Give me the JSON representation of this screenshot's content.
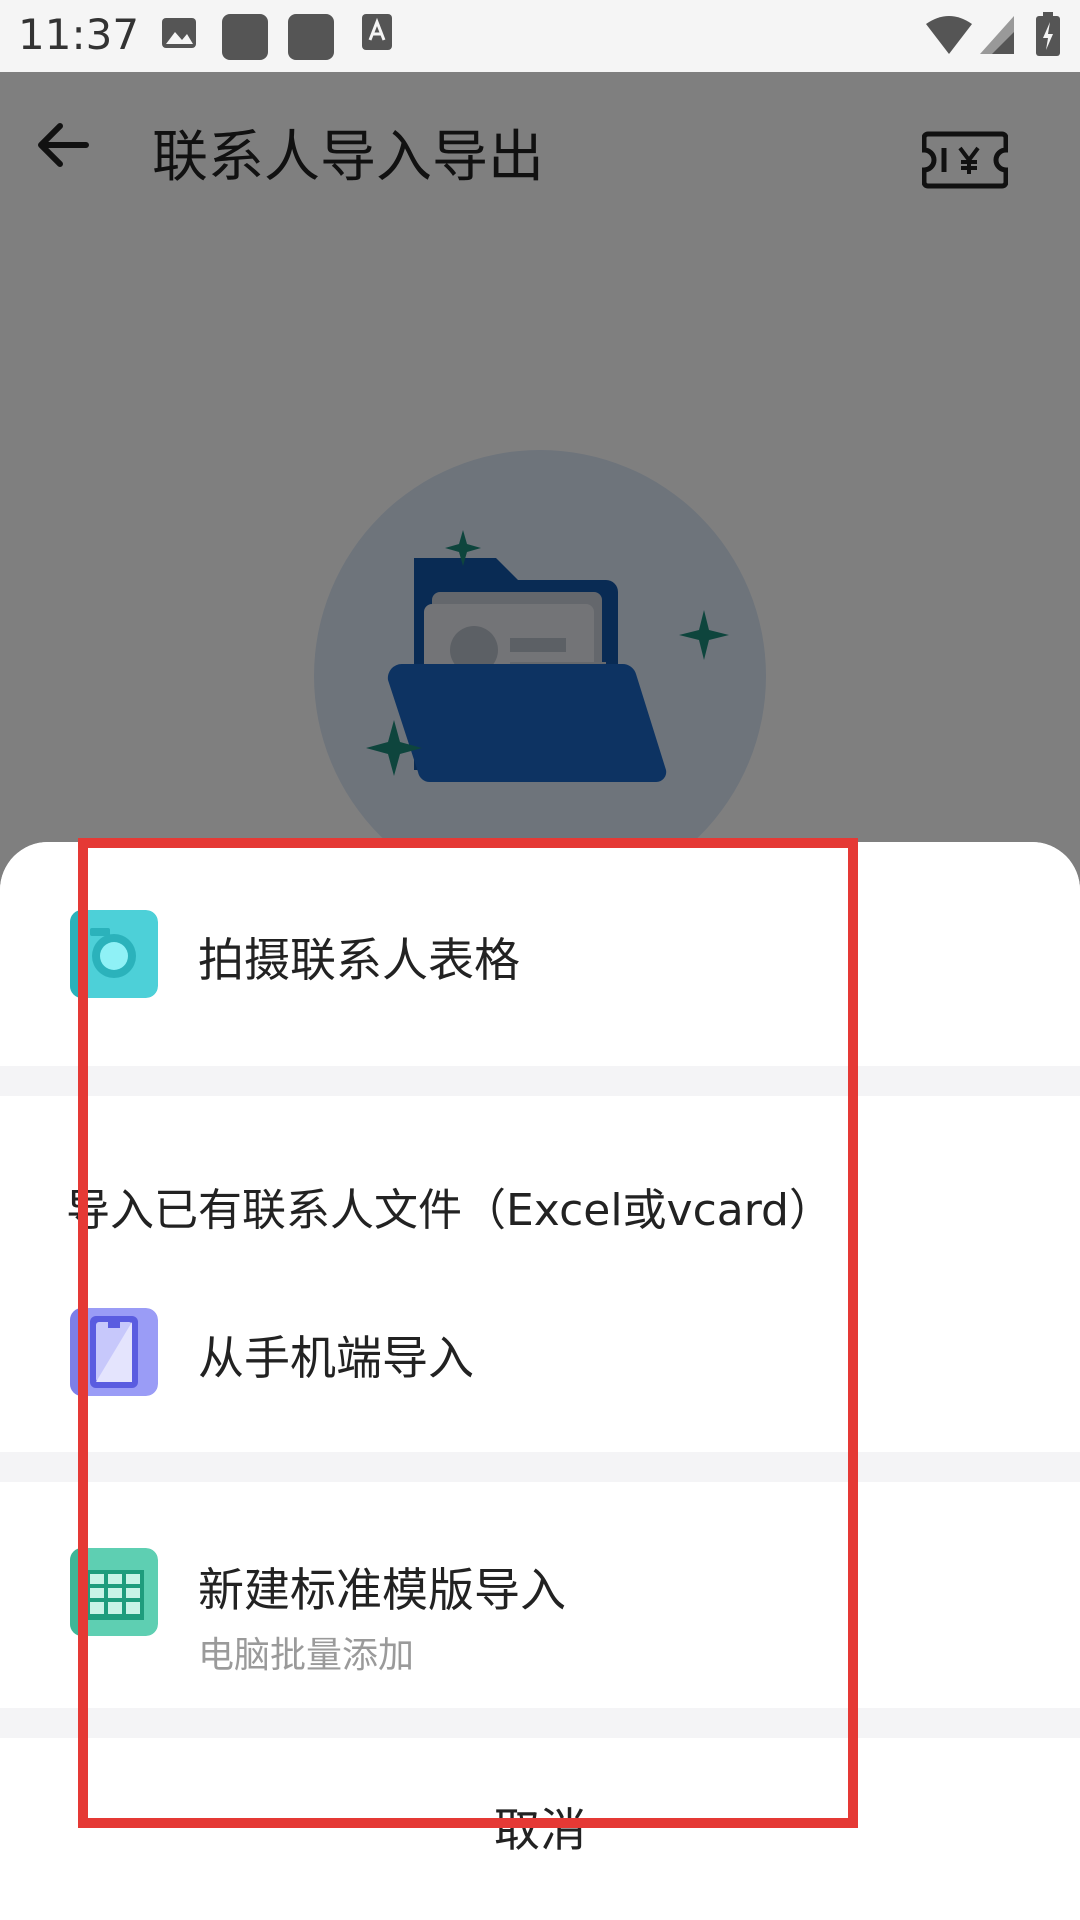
{
  "status_bar": {
    "time": "11:37"
  },
  "page": {
    "title": "联系人导入导出"
  },
  "sheet": {
    "photo_option": {
      "label": "拍摄联系人表格"
    },
    "import_section": {
      "heading": "导入已有联系人文件（Excel或vcard）",
      "phone_option": {
        "label": "从手机端导入"
      }
    },
    "template_option": {
      "label": "新建标准模版导入",
      "sublabel": "电脑批量添加"
    },
    "cancel_label": "取消"
  },
  "colors": {
    "highlight": "#e53935",
    "camera_icon": "#4dd0d8",
    "phone_icon": "#9a9cf6",
    "template_icon": "#5ecfb2",
    "folder": "#1565c0"
  },
  "icons": [
    "back-arrow-icon",
    "ticket-yen-icon",
    "camera-icon",
    "phone-icon",
    "spreadsheet-icon",
    "image-icon",
    "keyboard-icon",
    "wifi-icon",
    "signal-icon",
    "battery-icon"
  ]
}
